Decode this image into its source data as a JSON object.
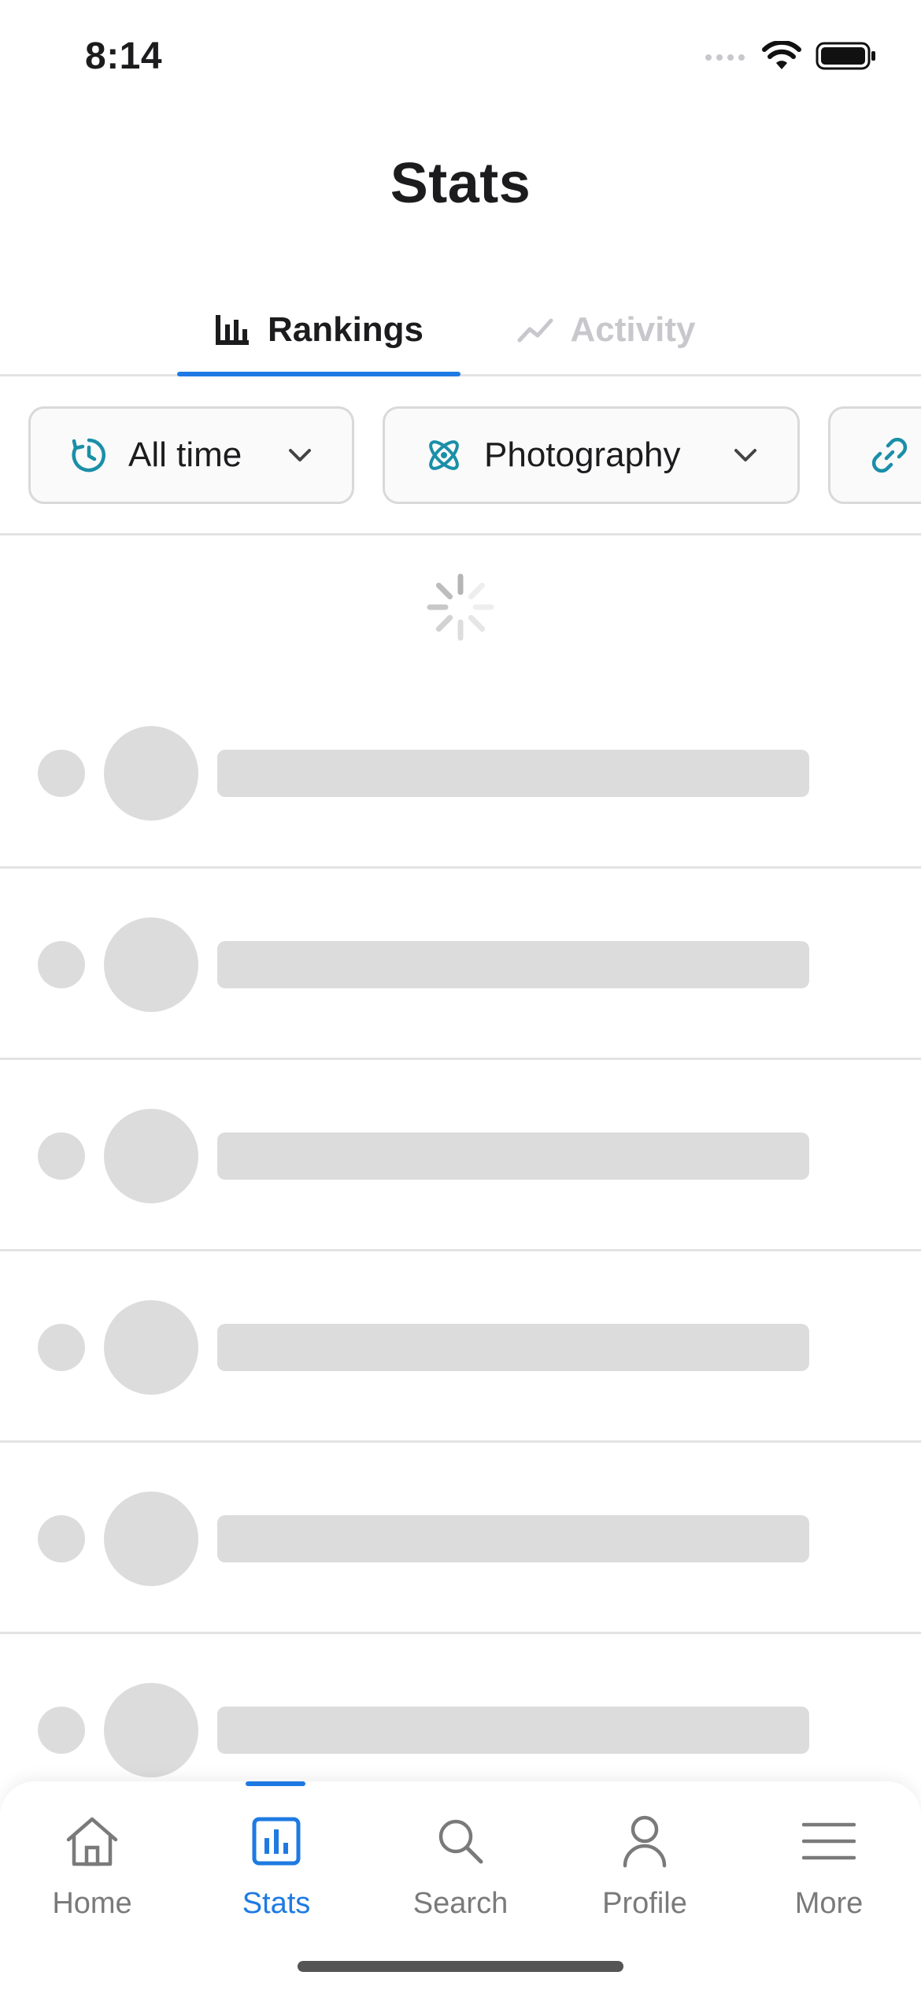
{
  "status_bar": {
    "time": "8:14"
  },
  "header": {
    "title": "Stats"
  },
  "tabs": [
    {
      "label": "Rankings",
      "icon": "bar-chart-icon",
      "active": true
    },
    {
      "label": "Activity",
      "icon": "trend-line-icon",
      "active": false
    }
  ],
  "filters": {
    "time": {
      "label": "All time",
      "icon": "clock-refresh-icon"
    },
    "category": {
      "label": "Photography",
      "icon": "atom-icon"
    },
    "link": {
      "icon": "link-icon"
    }
  },
  "loading": true,
  "skeleton_rows": 6,
  "bottom_nav": [
    {
      "label": "Home",
      "icon": "home-icon",
      "active": false
    },
    {
      "label": "Stats",
      "icon": "stats-icon",
      "active": true
    },
    {
      "label": "Search",
      "icon": "search-icon",
      "active": false
    },
    {
      "label": "Profile",
      "icon": "profile-icon",
      "active": false
    },
    {
      "label": "More",
      "icon": "menu-icon",
      "active": false
    }
  ],
  "colors": {
    "accent": "#1e7ae2",
    "teal_icon": "#1a8fa8",
    "skeleton": "#dcdcdc",
    "inactive": "#7a7a7a"
  }
}
